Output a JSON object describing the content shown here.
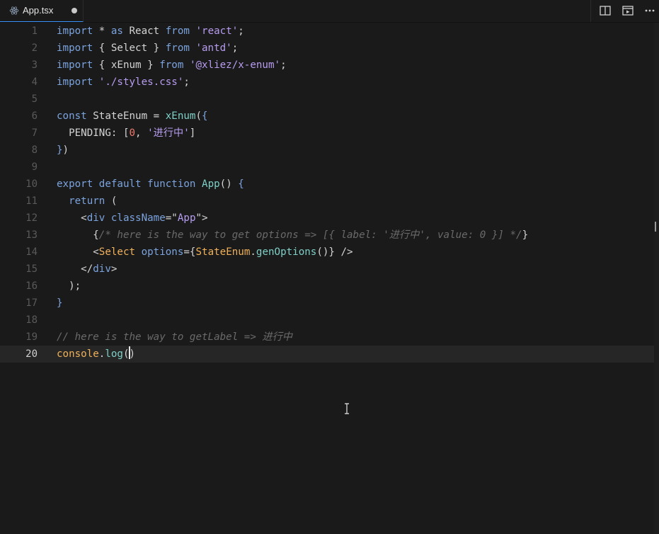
{
  "tab": {
    "title": "App.tsx",
    "icon": "react-icon",
    "unsaved": true
  },
  "actions": [
    "split-editor-icon",
    "open-preview-icon",
    "more-actions-icon"
  ],
  "editor": {
    "active_line": 20,
    "lines": [
      {
        "n": "1",
        "t": [
          [
            "kw",
            "import"
          ],
          [
            "p",
            " * "
          ],
          [
            "kw",
            "as"
          ],
          [
            "p",
            " React "
          ],
          [
            "kw",
            "from"
          ],
          [
            "p",
            " "
          ],
          [
            "str",
            "'react'"
          ],
          [
            "p",
            ";"
          ]
        ]
      },
      {
        "n": "2",
        "t": [
          [
            "kw",
            "import"
          ],
          [
            "p",
            " { Select } "
          ],
          [
            "kw",
            "from"
          ],
          [
            "p",
            " "
          ],
          [
            "str",
            "'antd'"
          ],
          [
            "p",
            ";"
          ]
        ]
      },
      {
        "n": "3",
        "t": [
          [
            "kw",
            "import"
          ],
          [
            "p",
            " { xEnum } "
          ],
          [
            "kw",
            "from"
          ],
          [
            "p",
            " "
          ],
          [
            "str",
            "'@xliez/x-enum'"
          ],
          [
            "p",
            ";"
          ]
        ]
      },
      {
        "n": "4",
        "t": [
          [
            "kw",
            "import"
          ],
          [
            "p",
            " "
          ],
          [
            "str",
            "'./styles.css'"
          ],
          [
            "p",
            ";"
          ]
        ]
      },
      {
        "n": "5",
        "t": []
      },
      {
        "n": "6",
        "t": [
          [
            "kw",
            "const"
          ],
          [
            "p",
            " StateEnum = "
          ],
          [
            "fn",
            "xEnum"
          ],
          [
            "p",
            "("
          ],
          [
            "kw",
            "{"
          ]
        ]
      },
      {
        "n": "7",
        "t": [
          [
            "p",
            "  PENDING: ["
          ],
          [
            "num",
            "0"
          ],
          [
            "p",
            ", "
          ],
          [
            "str",
            "'进行中'"
          ],
          [
            "p",
            "]"
          ]
        ]
      },
      {
        "n": "8",
        "t": [
          [
            "kw",
            "}"
          ],
          [
            "p",
            ")"
          ]
        ]
      },
      {
        "n": "9",
        "t": []
      },
      {
        "n": "10",
        "t": [
          [
            "kw",
            "export"
          ],
          [
            "p",
            " "
          ],
          [
            "kw",
            "default"
          ],
          [
            "p",
            " "
          ],
          [
            "kw",
            "function"
          ],
          [
            "p",
            " "
          ],
          [
            "fn",
            "App"
          ],
          [
            "p",
            "() "
          ],
          [
            "kw",
            "{"
          ]
        ]
      },
      {
        "n": "11",
        "t": [
          [
            "p",
            "  "
          ],
          [
            "kw",
            "return"
          ],
          [
            "p",
            " ("
          ]
        ]
      },
      {
        "n": "12",
        "t": [
          [
            "p",
            "    <"
          ],
          [
            "kw",
            "div"
          ],
          [
            "p",
            " "
          ],
          [
            "kw",
            "className"
          ],
          [
            "p",
            "=\""
          ],
          [
            "str",
            "App"
          ],
          [
            "p",
            "\">"
          ]
        ]
      },
      {
        "n": "13",
        "t": [
          [
            "p",
            "      {"
          ],
          [
            "cm",
            "/* here is the way to get options => [{ label: '进行中', value: 0 }] */"
          ],
          [
            "p",
            "}"
          ]
        ]
      },
      {
        "n": "14",
        "t": [
          [
            "p",
            "      <"
          ],
          [
            "yel",
            "Select"
          ],
          [
            "p",
            " "
          ],
          [
            "kw",
            "options"
          ],
          [
            "p",
            "={"
          ],
          [
            "yel",
            "StateEnum"
          ],
          [
            "p",
            "."
          ],
          [
            "fn",
            "genOptions"
          ],
          [
            "p",
            "()} />"
          ]
        ]
      },
      {
        "n": "15",
        "t": [
          [
            "p",
            "    </"
          ],
          [
            "kw",
            "div"
          ],
          [
            "p",
            ">"
          ]
        ]
      },
      {
        "n": "16",
        "t": [
          [
            "p",
            "  );"
          ]
        ]
      },
      {
        "n": "17",
        "t": [
          [
            "kw",
            "}"
          ]
        ]
      },
      {
        "n": "18",
        "t": []
      },
      {
        "n": "19",
        "t": [
          [
            "cm",
            "// here is the way to getLabel => 进行中"
          ]
        ]
      },
      {
        "n": "20",
        "t": [
          [
            "yel",
            "console"
          ],
          [
            "p",
            "."
          ],
          [
            "fn",
            "log"
          ],
          [
            "p",
            "("
          ],
          [
            "cursor",
            ""
          ],
          [
            "p",
            ")"
          ]
        ]
      }
    ]
  }
}
